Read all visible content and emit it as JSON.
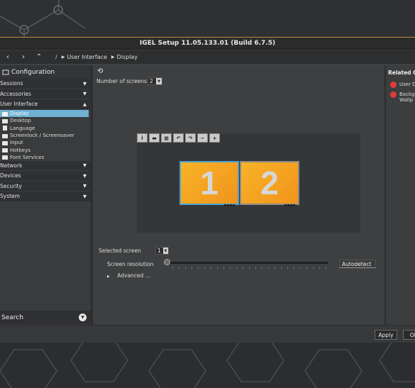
{
  "window": {
    "title": "IGEL Setup 11.05.133.01 (Build 6.7.5)"
  },
  "nav": {
    "back": "‹",
    "forward": "›",
    "up": "⌃",
    "root": "/",
    "crumbs": [
      "User Interface",
      "Display"
    ]
  },
  "sidebar": {
    "heading": "Configuration",
    "sections_top": [
      {
        "label": "Sessions",
        "arrow": "▼"
      },
      {
        "label": "Accessories",
        "arrow": "▼"
      },
      {
        "label": "User Interface",
        "arrow": "▲"
      }
    ],
    "ui_items": [
      "Display",
      "Desktop",
      "Language",
      "Screenlock / Screensaver",
      "Input",
      "Hotkeys",
      "Font Services"
    ],
    "sections_bottom": [
      {
        "label": "Network",
        "arrow": "▼"
      },
      {
        "label": "Devices",
        "arrow": "▼"
      },
      {
        "label": "Security",
        "arrow": "▼"
      },
      {
        "label": "System",
        "arrow": "▼"
      }
    ],
    "search_label": "Search",
    "search_arrow": "▼"
  },
  "display": {
    "num_screens_label": "Number of screens",
    "num_screens_value": "2",
    "toolbar_icons": [
      "info-icon",
      "one-row-icon",
      "grid-icon",
      "rotate-left-icon",
      "rotate-right-icon",
      "minus-icon",
      "plus-icon"
    ],
    "toolbar_glyphs": [
      "i",
      "▬",
      "▦",
      "↶",
      "↷",
      "−",
      "+"
    ],
    "screen1": "1",
    "screen2": "2",
    "selected_screen_label": "Selected screen",
    "selected_screen_value": "1",
    "resolution_label": "Screen resolution",
    "autodetect_label": "Autodetect",
    "advanced_label": "Advanced ..."
  },
  "related": {
    "title": "Related C",
    "items": [
      {
        "lines": [
          "User D"
        ]
      },
      {
        "lines": [
          "Backg",
          "Wallp"
        ]
      }
    ]
  },
  "buttons": {
    "apply": "Apply",
    "ok": "Ok"
  }
}
